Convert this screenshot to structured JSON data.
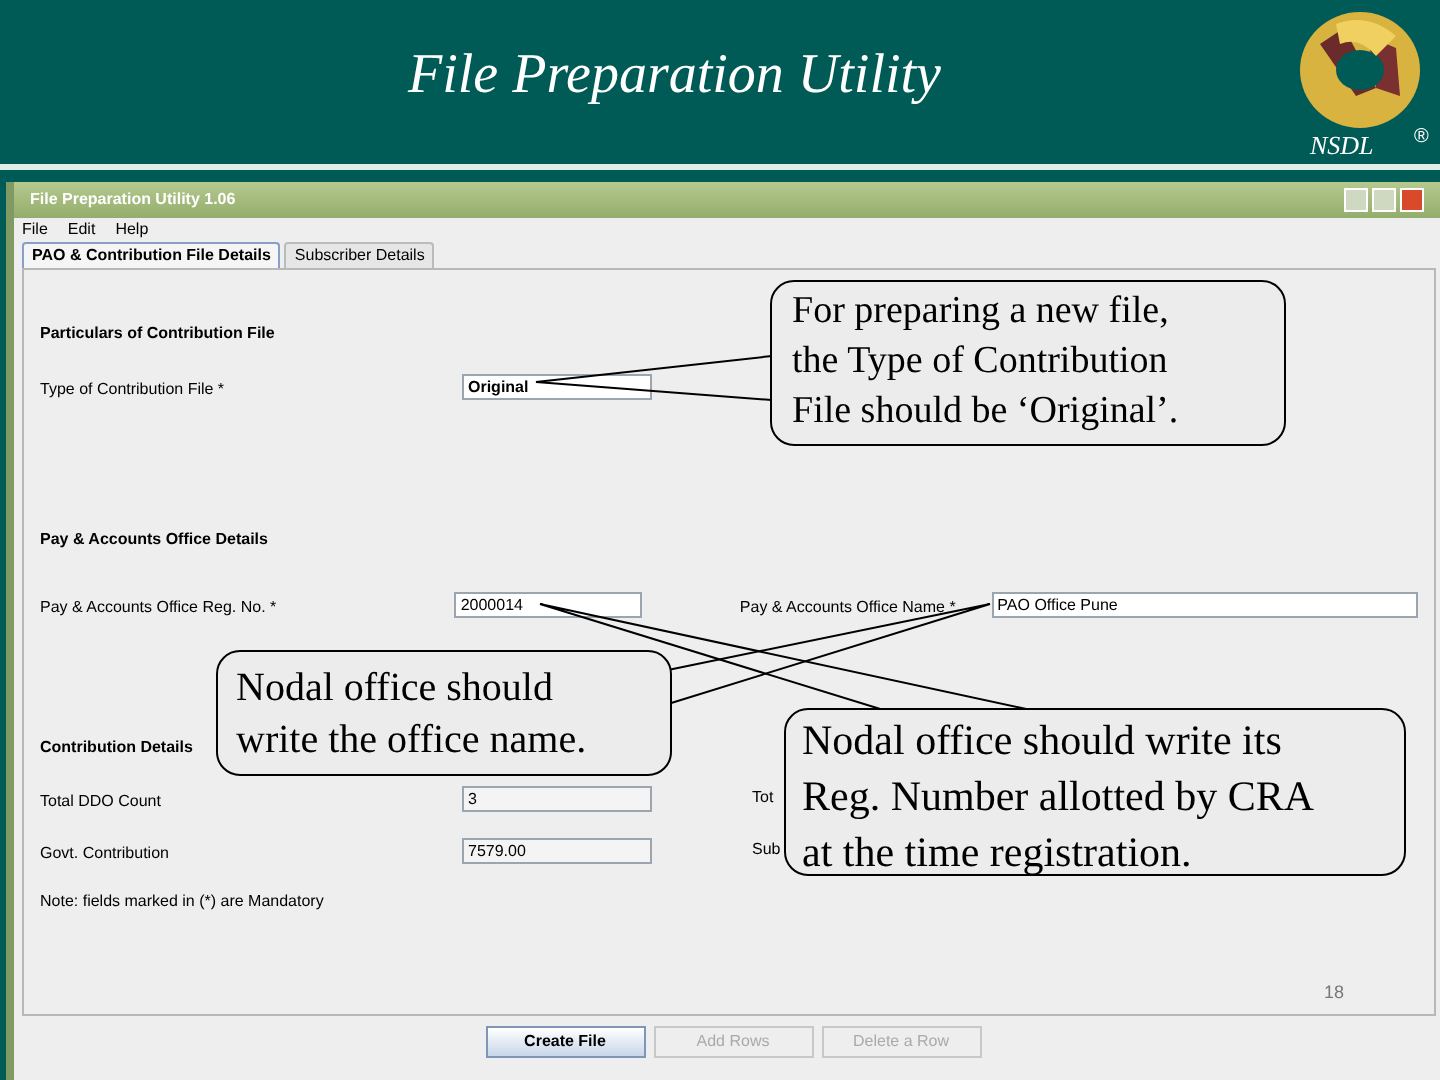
{
  "slide": {
    "title": "File Preparation Utility",
    "logo_text": "NSDL",
    "registered_mark": "®",
    "page_number": "18"
  },
  "window": {
    "title": "File Preparation Utility 1.06"
  },
  "menu": [
    "File",
    "Edit",
    "Help"
  ],
  "tabs": [
    {
      "label": "PAO & Contribution File Details",
      "selected": true
    },
    {
      "label": "Subscriber Details",
      "selected": false
    }
  ],
  "form": {
    "section_1": "Particulars of Contribution File",
    "contribution_type": {
      "label": "Type of Contribution File *",
      "value": "Original"
    },
    "section_2": "Pay & Accounts Office Details",
    "reg_no": {
      "label": "Pay & Accounts Office Reg. No. *",
      "value": "2000014"
    },
    "office_name": {
      "label": "Pay & Accounts Office Name *",
      "value": "PAO Office Pune"
    },
    "section_3": "Contribution Details",
    "ddo_count": {
      "label": "Total DDO Count",
      "value": "3"
    },
    "govt_contribution": {
      "label": "Govt. Contribution",
      "value": "7579.00"
    },
    "right_label_1": "Tot",
    "right_label_2": "Sub",
    "note": "Note: fields marked in (*) are Mandatory"
  },
  "buttons": [
    {
      "label": "Create File",
      "disabled": false
    },
    {
      "label": "Add Rows",
      "disabled": true
    },
    {
      "label": "Delete a Row",
      "disabled": true
    }
  ],
  "callouts": [
    [
      "For preparing a new file,",
      "the Type of Contribution",
      "File should be ‘Original’."
    ],
    [
      "Nodal office should",
      "write the office name."
    ],
    [
      "Nodal office should write its",
      "Reg. Number allotted by CRA",
      "at the time registration."
    ]
  ]
}
